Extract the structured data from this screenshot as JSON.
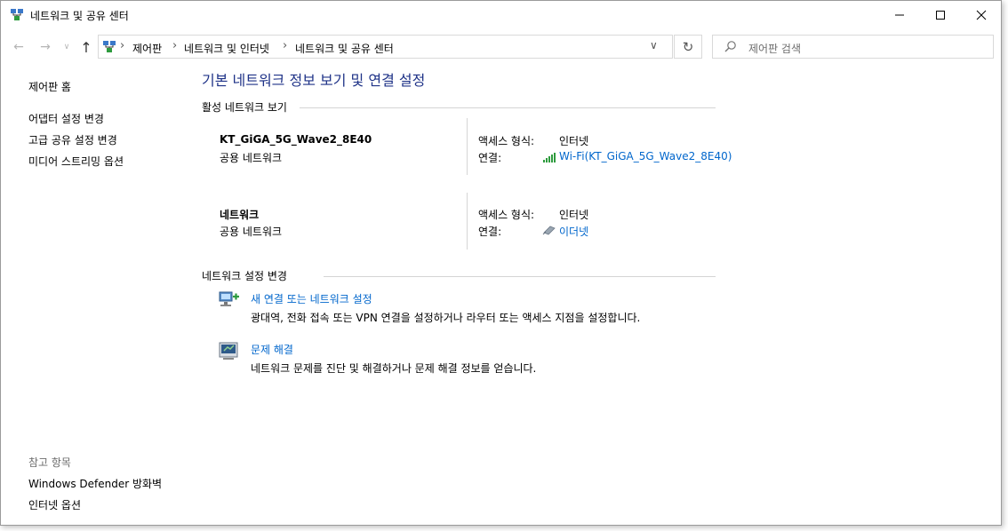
{
  "window": {
    "title": "네트워크 및 공유 센터",
    "icon": "network-center-icon",
    "controls": [
      "minimize-icon",
      "maximize-icon",
      "close-icon"
    ]
  },
  "address": {
    "breadcrumbs": [
      "제어판",
      "네트워크 및 인터넷",
      "네트워크 및 공유 센터"
    ],
    "search_placeholder": "제어판 검색"
  },
  "sidebar": {
    "home": "제어판 홈",
    "links": [
      "어댑터 설정 변경",
      "고급 공유 설정 변경",
      "미디어 스트리밍 옵션"
    ],
    "see_also_heading": "참고 항목",
    "see_also": [
      "Windows Defender 방화벽",
      "인터넷 옵션"
    ]
  },
  "main": {
    "title": "기본 네트워크 정보 보기 및 연결 설정",
    "active_heading": "활성 네트워크 보기",
    "networks": [
      {
        "name": "KT_GiGA_5G_Wave2_8E40",
        "type": "공용 네트워크",
        "access_label": "액세스 형식:",
        "access_value": "인터넷",
        "conn_label": "연결:",
        "conn_value": "Wi-Fi(KT_GiGA_5G_Wave2_8E40)",
        "conn_icon": "wifi-signal-icon"
      },
      {
        "name": "네트워크",
        "type": "공용 네트워크",
        "access_label": "액세스 형식:",
        "access_value": "인터넷",
        "conn_label": "연결:",
        "conn_value": "이더넷",
        "conn_icon": "ethernet-icon"
      }
    ],
    "change_heading": "네트워크 설정 변경",
    "tasks": [
      {
        "link": "새 연결 또는 네트워크 설정",
        "desc": "광대역, 전화 접속 또는 VPN 연결을 설정하거나 라우터 또는 액세스 지점을 설정합니다."
      },
      {
        "link": "문제 해결",
        "desc": "네트워크 문제를 진단 및 해결하거나 문제 해결 정보를 얻습니다."
      }
    ]
  },
  "colors": {
    "title_blue": "#1e3287",
    "link_blue": "#0066cc",
    "muted": "#6d6d6d"
  }
}
